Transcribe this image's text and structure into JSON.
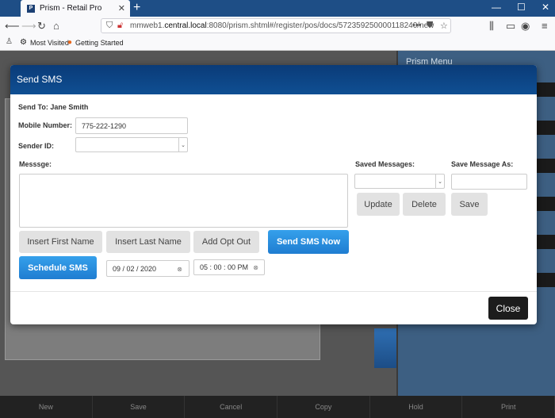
{
  "browser": {
    "tab_title": "Prism - Retail Pro",
    "favicon_text": "P",
    "url_scheme_host": "mmweb1.",
    "url_domain": "central.local",
    "url_rest": ":8080/prism.shtml#/register/pos/docs/572359250000118240/new",
    "bookmarks": [
      "Most Visited",
      "Getting Started"
    ]
  },
  "app": {
    "side_menu_title": "Prism Menu",
    "bottom_bar": [
      "New",
      "Save",
      "Cancel",
      "Copy",
      "Hold",
      "Print"
    ]
  },
  "modal": {
    "title": "Send SMS",
    "send_to": "Send To: Jane Smith",
    "mobile_label": "Mobile Number:",
    "mobile_value": "775-222-1290",
    "sender_label": "Sender ID:",
    "sender_value": "",
    "message_label": "Messsge:",
    "saved_messages_label": "Saved Messages:",
    "save_as_label": "Save Message As:",
    "save_as_value": "",
    "update_label": "Update",
    "delete_label": "Delete",
    "save_label": "Save",
    "insert_first_label": "Insert First Name",
    "insert_last_label": "Insert Last Name",
    "add_opt_out_label": "Add Opt Out",
    "send_now_label": "Send SMS Now",
    "schedule_label": "Schedule SMS",
    "date_value": "09 / 02 / 2020",
    "time_value": "05 : 00 : 00   PM",
    "close_label": "Close"
  },
  "colors": {
    "header": "#0f4f93",
    "primary_button": "#1f7dd1",
    "close_button": "#1c1c1c"
  }
}
